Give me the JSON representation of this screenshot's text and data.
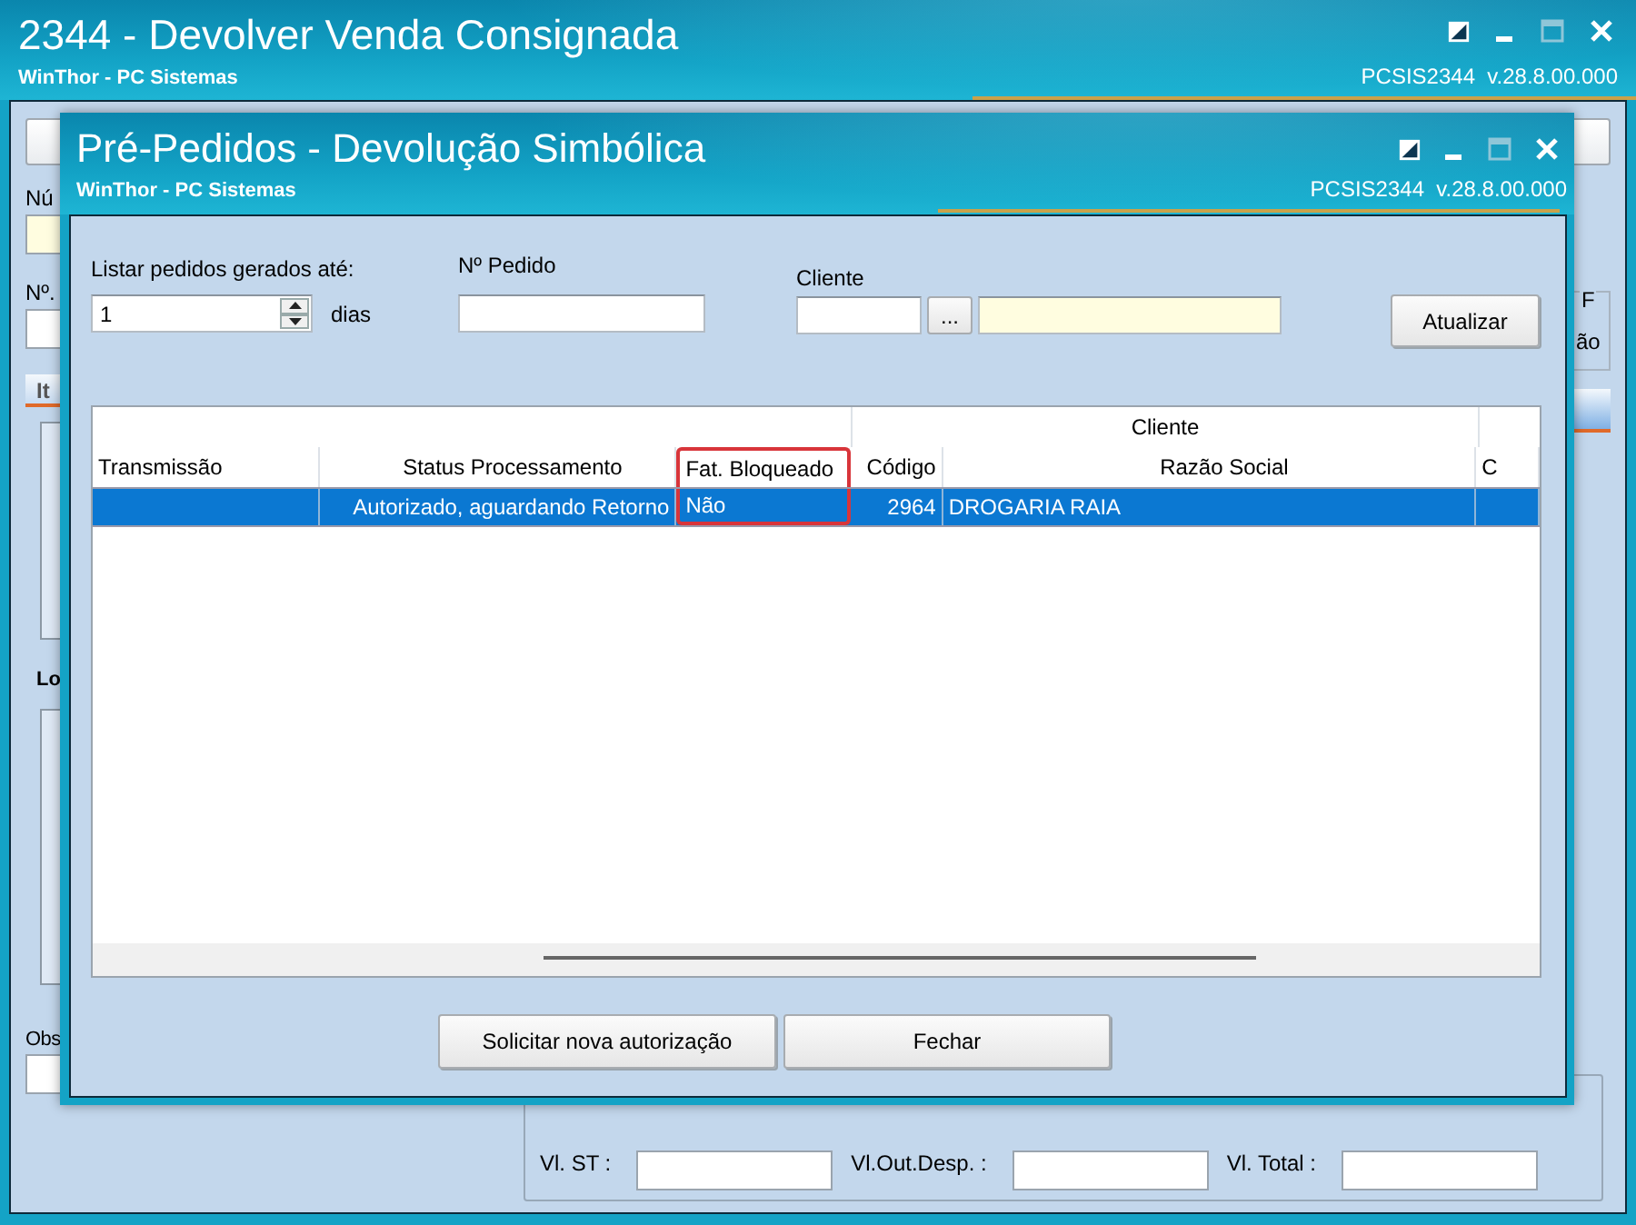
{
  "main_window": {
    "title": "2344 - Devolver Venda Consignada",
    "subtitle": "WinThor - PC Sistemas",
    "version": "PCSIS2344  v.28.8.00.000",
    "number_label": "Nú",
    "order_label": "Nº.",
    "tab_label": "It",
    "section_label": "Lo",
    "obs_label": "Obs",
    "side_group": {
      "legend": "F",
      "text": "ão"
    },
    "totals": [
      {
        "label": "Vl. ST :"
      },
      {
        "label": "Vl.Out.Desp. :"
      },
      {
        "label": "Vl. Total :"
      }
    ]
  },
  "dialog": {
    "title": "Pré-Pedidos - Devolução Simbólica",
    "subtitle": "WinThor - PC Sistemas",
    "version": "PCSIS2344  v.28.8.00.000",
    "days_filter": {
      "label": "Listar pedidos gerados até:",
      "value": "1",
      "unit": "dias"
    },
    "order_filter": {
      "label": "Nº Pedido"
    },
    "client_filter": {
      "label": "Cliente",
      "lookup": "..."
    },
    "refresh_button": "Atualizar",
    "grid": {
      "group_header": "Cliente",
      "columns": [
        {
          "label": "Transmissão",
          "highlighted": false
        },
        {
          "label": "Status Processamento",
          "highlighted": false
        },
        {
          "label": "Fat. Bloqueado",
          "highlighted": true
        },
        {
          "label": "Código",
          "highlighted": false
        },
        {
          "label": "Razão Social",
          "highlighted": false
        },
        {
          "label": "C",
          "highlighted": false
        }
      ],
      "rows": [
        {
          "cells": [
            null,
            "Autorizado, aguardando Retorno",
            "Não",
            "2964",
            "DROGARIA RAIA",
            null
          ],
          "selected": true
        }
      ]
    },
    "buttons": [
      "Solicitar nova autorização",
      "Fechar"
    ]
  }
}
